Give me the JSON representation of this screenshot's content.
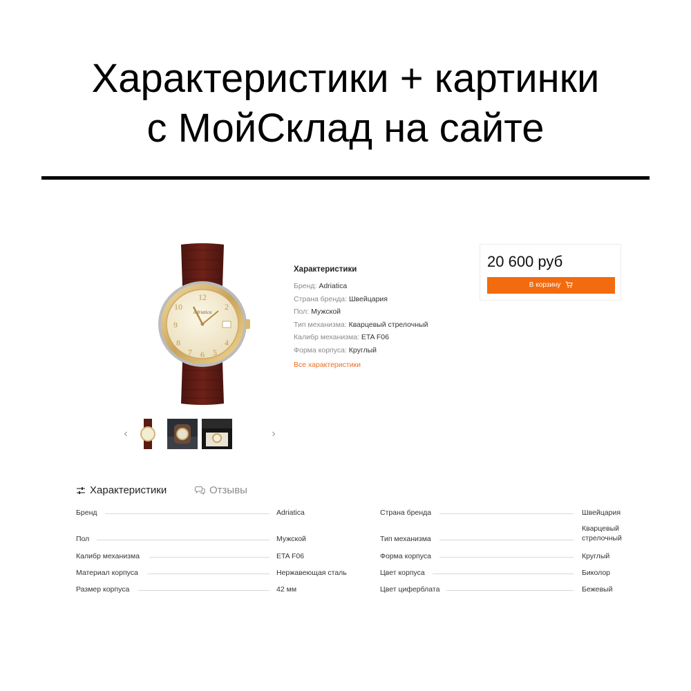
{
  "header": {
    "title_line1": "Характеристики + картинки",
    "title_line2": "с МойСклад на сайте"
  },
  "product": {
    "image_icon": "wristwatch-image",
    "thumbnails": [
      "watch-front-thumb",
      "watch-wrist-thumb",
      "watch-box-thumb"
    ],
    "prev_icon": "‹",
    "next_icon": "›"
  },
  "spec_preview": {
    "heading": "Характеристики",
    "rows": [
      {
        "label": "Бренд:",
        "value": "Adriatica"
      },
      {
        "label": "Страна бренда:",
        "value": "Швейцария"
      },
      {
        "label": "Пол:",
        "value": "Мужской"
      },
      {
        "label": "Тип механизма:",
        "value": "Кварцевый стрелочный"
      },
      {
        "label": "Калибр механизма:",
        "value": "ETA F06"
      },
      {
        "label": "Форма корпуса:",
        "value": "Круглый"
      }
    ],
    "all_link": "Все характеристики"
  },
  "price_box": {
    "price": "20 600 руб",
    "cart_label": "В корзину",
    "accent_color": "#f26b0f"
  },
  "tabs": {
    "specs_label": "Характеристики",
    "reviews_label": "Отзывы"
  },
  "spec_table": {
    "left": [
      {
        "label": "Бренд",
        "value": "Adriatica"
      },
      {
        "label": "Пол",
        "value": "Мужской"
      },
      {
        "label": "Калибр механизма",
        "value": "ETA F06"
      },
      {
        "label": "Материал корпуса",
        "value": "Нержавеющая сталь"
      },
      {
        "label": "Размер корпуса",
        "value": "42 мм"
      }
    ],
    "right": [
      {
        "label": "Страна бренда",
        "value": "Швейцария"
      },
      {
        "label": "Тип механизма",
        "value": "Кварцевый стрелочный"
      },
      {
        "label": "Форма корпуса",
        "value": "Круглый"
      },
      {
        "label": "Цвет корпуса",
        "value": "Биколор"
      },
      {
        "label": "Цвет циферблата",
        "value": "Бежевый"
      }
    ]
  }
}
